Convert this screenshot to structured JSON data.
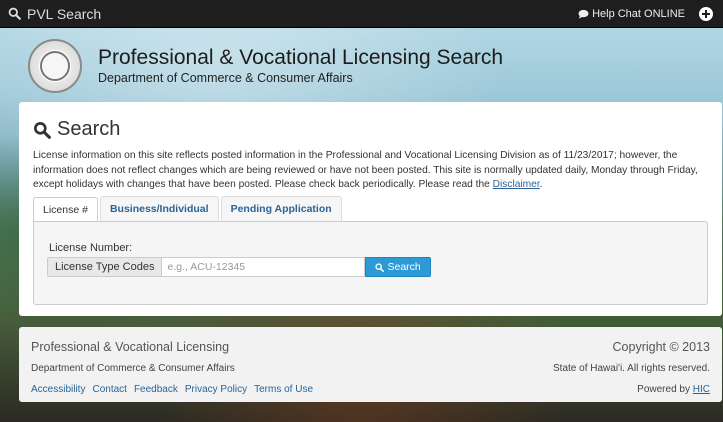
{
  "topbar": {
    "brand": "PVL Search",
    "chat": "Help Chat ONLINE"
  },
  "header": {
    "title": "Professional & Vocational Licensing Search",
    "subtitle": "Department of Commerce & Consumer Affairs"
  },
  "search": {
    "heading": "Search",
    "info_text": "License information on this site reflects posted information in the Professional and Vocational Licensing Division as of 11/23/2017; however, the information does not reflect changes which are being reviewed or have not been posted. This site is normally updated daily, Monday through Friday, except holidays with changes that have been posted. Please check back periodically. Please read the ",
    "disclaimer_link": "Disclaimer",
    "info_end": ".",
    "tabs": [
      {
        "label": "License #"
      },
      {
        "label": "Business/Individual"
      },
      {
        "label": "Pending Application"
      }
    ],
    "license_label": "License Number:",
    "type_codes": "License Type Codes",
    "placeholder": "e.g., ACU-12345",
    "button": "Search"
  },
  "footer": {
    "title": "Professional & Vocational Licensing",
    "dept": "Department of Commerce & Consumer Affairs",
    "links": [
      "Accessibility",
      "Contact",
      "Feedback",
      "Privacy Policy",
      "Terms of Use"
    ],
    "copyright": "Copyright © 2013",
    "rights": "State of Hawai'i. All rights reserved.",
    "powered_prefix": "Powered by ",
    "powered_link": "HIC"
  }
}
